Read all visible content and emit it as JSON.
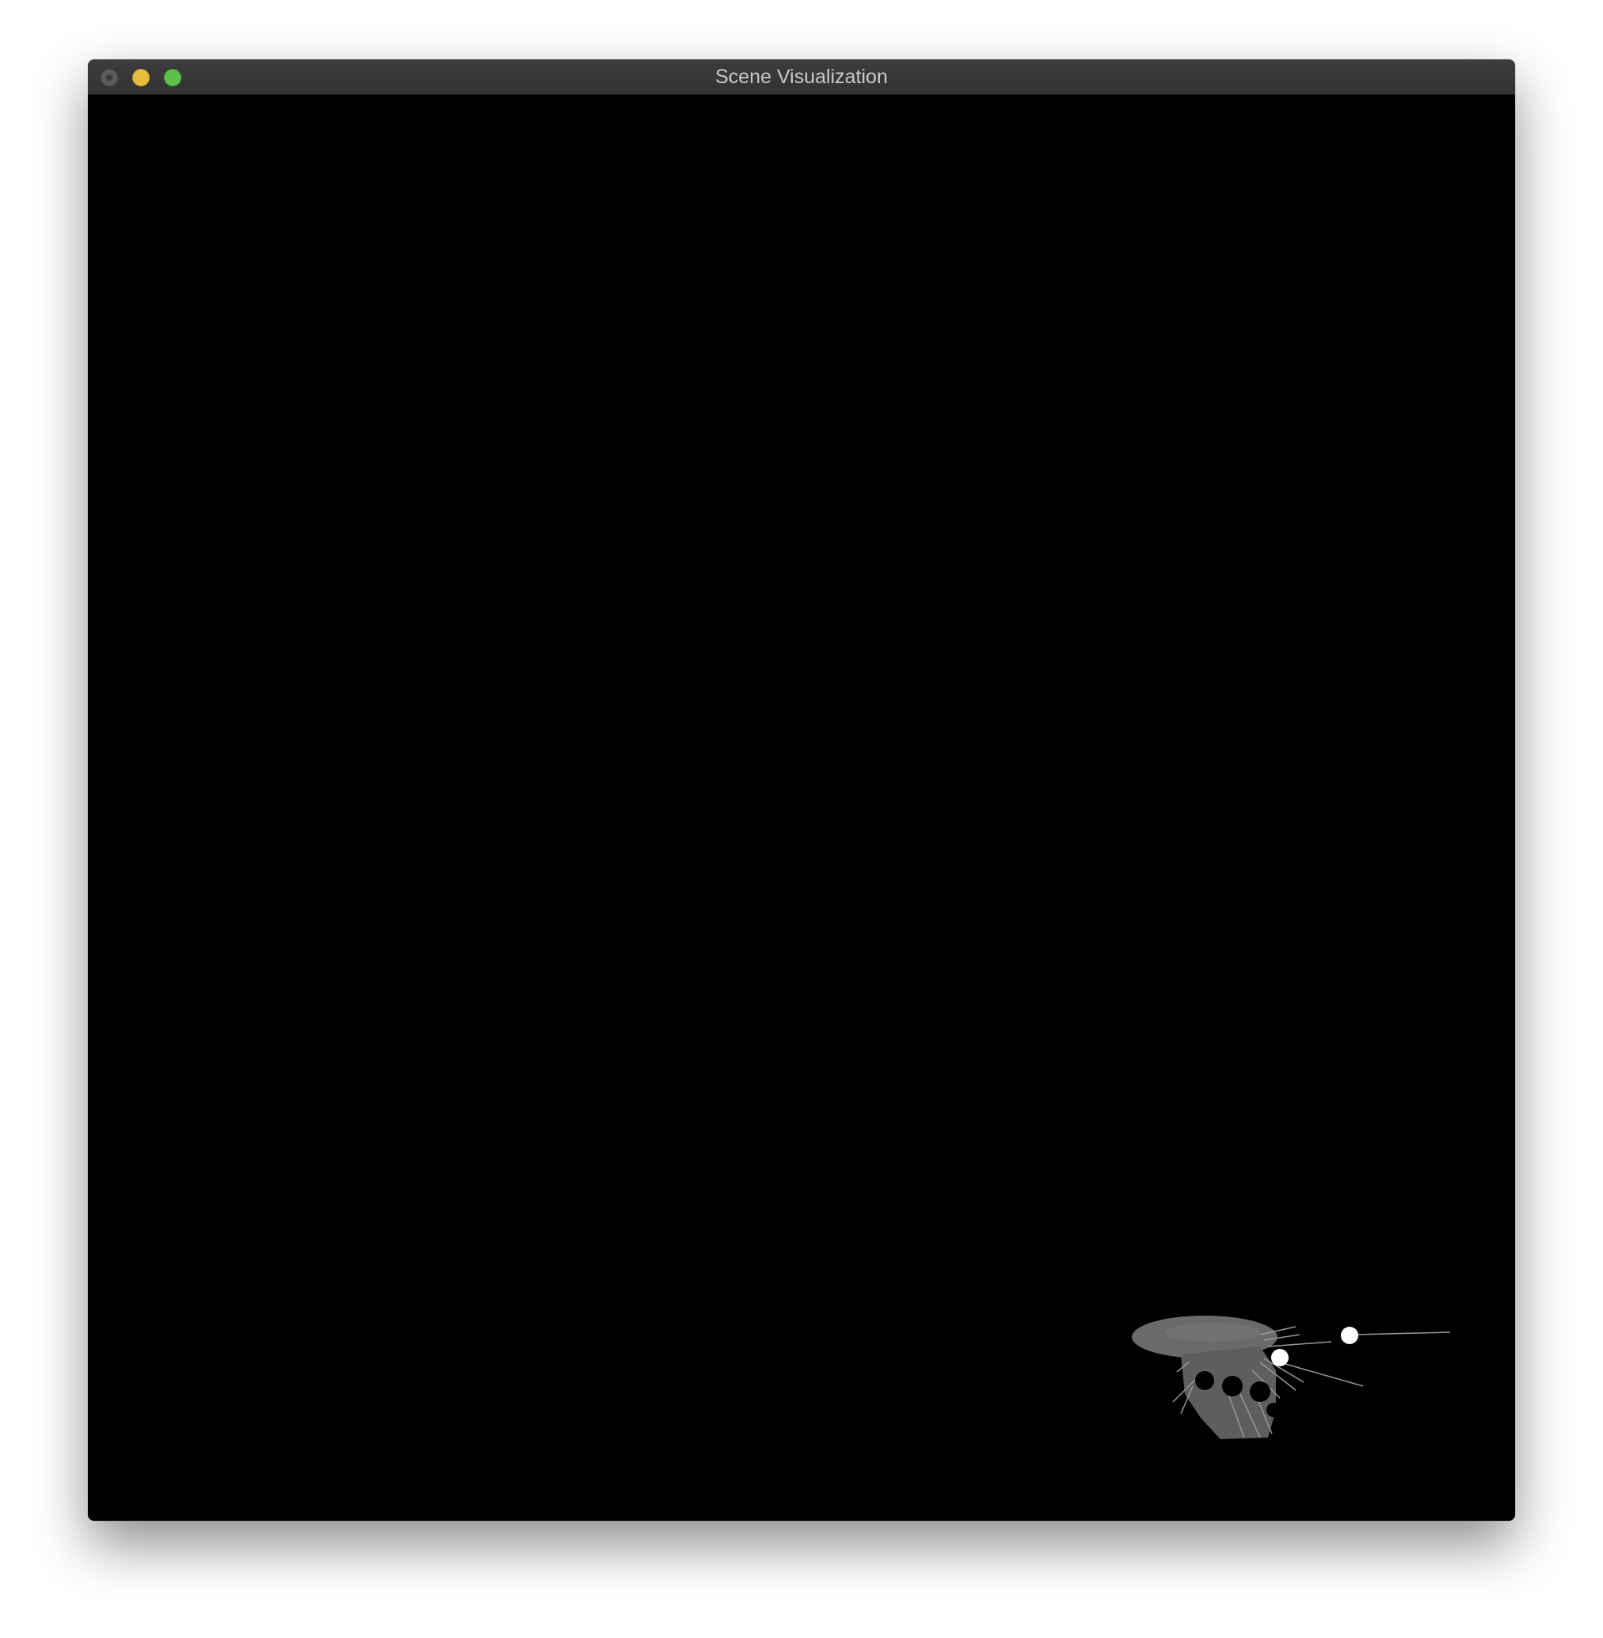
{
  "window": {
    "title": "Scene Visualization",
    "background": "#000000"
  },
  "titlebar": {
    "buttons": [
      {
        "name": "close",
        "color": "#5b5b5d",
        "enabled": false
      },
      {
        "name": "minimize",
        "color": "#e6bd3e",
        "enabled": true
      },
      {
        "name": "zoom",
        "color": "#5ec04a",
        "enabled": true
      }
    ]
  },
  "scene": {
    "description_icon": "point-cloud-3d",
    "point_color": "#6e6e6e",
    "highlight_color": "#ffffff"
  }
}
